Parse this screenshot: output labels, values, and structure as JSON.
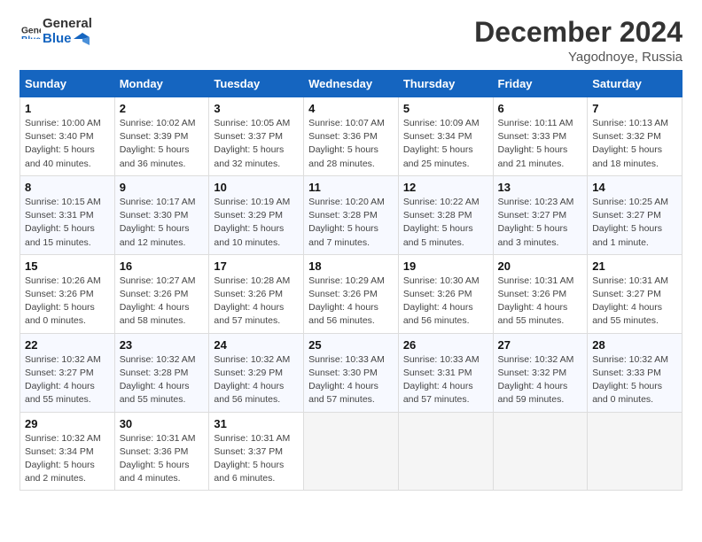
{
  "header": {
    "logo_line1": "General",
    "logo_line2": "Blue",
    "month": "December 2024",
    "location": "Yagodnoye, Russia"
  },
  "weekdays": [
    "Sunday",
    "Monday",
    "Tuesday",
    "Wednesday",
    "Thursday",
    "Friday",
    "Saturday"
  ],
  "weeks": [
    [
      {
        "day": "1",
        "sunrise": "Sunrise: 10:00 AM",
        "sunset": "Sunset: 3:40 PM",
        "daylight": "Daylight: 5 hours and 40 minutes."
      },
      {
        "day": "2",
        "sunrise": "Sunrise: 10:02 AM",
        "sunset": "Sunset: 3:39 PM",
        "daylight": "Daylight: 5 hours and 36 minutes."
      },
      {
        "day": "3",
        "sunrise": "Sunrise: 10:05 AM",
        "sunset": "Sunset: 3:37 PM",
        "daylight": "Daylight: 5 hours and 32 minutes."
      },
      {
        "day": "4",
        "sunrise": "Sunrise: 10:07 AM",
        "sunset": "Sunset: 3:36 PM",
        "daylight": "Daylight: 5 hours and 28 minutes."
      },
      {
        "day": "5",
        "sunrise": "Sunrise: 10:09 AM",
        "sunset": "Sunset: 3:34 PM",
        "daylight": "Daylight: 5 hours and 25 minutes."
      },
      {
        "day": "6",
        "sunrise": "Sunrise: 10:11 AM",
        "sunset": "Sunset: 3:33 PM",
        "daylight": "Daylight: 5 hours and 21 minutes."
      },
      {
        "day": "7",
        "sunrise": "Sunrise: 10:13 AM",
        "sunset": "Sunset: 3:32 PM",
        "daylight": "Daylight: 5 hours and 18 minutes."
      }
    ],
    [
      {
        "day": "8",
        "sunrise": "Sunrise: 10:15 AM",
        "sunset": "Sunset: 3:31 PM",
        "daylight": "Daylight: 5 hours and 15 minutes."
      },
      {
        "day": "9",
        "sunrise": "Sunrise: 10:17 AM",
        "sunset": "Sunset: 3:30 PM",
        "daylight": "Daylight: 5 hours and 12 minutes."
      },
      {
        "day": "10",
        "sunrise": "Sunrise: 10:19 AM",
        "sunset": "Sunset: 3:29 PM",
        "daylight": "Daylight: 5 hours and 10 minutes."
      },
      {
        "day": "11",
        "sunrise": "Sunrise: 10:20 AM",
        "sunset": "Sunset: 3:28 PM",
        "daylight": "Daylight: 5 hours and 7 minutes."
      },
      {
        "day": "12",
        "sunrise": "Sunrise: 10:22 AM",
        "sunset": "Sunset: 3:28 PM",
        "daylight": "Daylight: 5 hours and 5 minutes."
      },
      {
        "day": "13",
        "sunrise": "Sunrise: 10:23 AM",
        "sunset": "Sunset: 3:27 PM",
        "daylight": "Daylight: 5 hours and 3 minutes."
      },
      {
        "day": "14",
        "sunrise": "Sunrise: 10:25 AM",
        "sunset": "Sunset: 3:27 PM",
        "daylight": "Daylight: 5 hours and 1 minute."
      }
    ],
    [
      {
        "day": "15",
        "sunrise": "Sunrise: 10:26 AM",
        "sunset": "Sunset: 3:26 PM",
        "daylight": "Daylight: 5 hours and 0 minutes."
      },
      {
        "day": "16",
        "sunrise": "Sunrise: 10:27 AM",
        "sunset": "Sunset: 3:26 PM",
        "daylight": "Daylight: 4 hours and 58 minutes."
      },
      {
        "day": "17",
        "sunrise": "Sunrise: 10:28 AM",
        "sunset": "Sunset: 3:26 PM",
        "daylight": "Daylight: 4 hours and 57 minutes."
      },
      {
        "day": "18",
        "sunrise": "Sunrise: 10:29 AM",
        "sunset": "Sunset: 3:26 PM",
        "daylight": "Daylight: 4 hours and 56 minutes."
      },
      {
        "day": "19",
        "sunrise": "Sunrise: 10:30 AM",
        "sunset": "Sunset: 3:26 PM",
        "daylight": "Daylight: 4 hours and 56 minutes."
      },
      {
        "day": "20",
        "sunrise": "Sunrise: 10:31 AM",
        "sunset": "Sunset: 3:26 PM",
        "daylight": "Daylight: 4 hours and 55 minutes."
      },
      {
        "day": "21",
        "sunrise": "Sunrise: 10:31 AM",
        "sunset": "Sunset: 3:27 PM",
        "daylight": "Daylight: 4 hours and 55 minutes."
      }
    ],
    [
      {
        "day": "22",
        "sunrise": "Sunrise: 10:32 AM",
        "sunset": "Sunset: 3:27 PM",
        "daylight": "Daylight: 4 hours and 55 minutes."
      },
      {
        "day": "23",
        "sunrise": "Sunrise: 10:32 AM",
        "sunset": "Sunset: 3:28 PM",
        "daylight": "Daylight: 4 hours and 55 minutes."
      },
      {
        "day": "24",
        "sunrise": "Sunrise: 10:32 AM",
        "sunset": "Sunset: 3:29 PM",
        "daylight": "Daylight: 4 hours and 56 minutes."
      },
      {
        "day": "25",
        "sunrise": "Sunrise: 10:33 AM",
        "sunset": "Sunset: 3:30 PM",
        "daylight": "Daylight: 4 hours and 57 minutes."
      },
      {
        "day": "26",
        "sunrise": "Sunrise: 10:33 AM",
        "sunset": "Sunset: 3:31 PM",
        "daylight": "Daylight: 4 hours and 57 minutes."
      },
      {
        "day": "27",
        "sunrise": "Sunrise: 10:32 AM",
        "sunset": "Sunset: 3:32 PM",
        "daylight": "Daylight: 4 hours and 59 minutes."
      },
      {
        "day": "28",
        "sunrise": "Sunrise: 10:32 AM",
        "sunset": "Sunset: 3:33 PM",
        "daylight": "Daylight: 5 hours and 0 minutes."
      }
    ],
    [
      {
        "day": "29",
        "sunrise": "Sunrise: 10:32 AM",
        "sunset": "Sunset: 3:34 PM",
        "daylight": "Daylight: 5 hours and 2 minutes."
      },
      {
        "day": "30",
        "sunrise": "Sunrise: 10:31 AM",
        "sunset": "Sunset: 3:36 PM",
        "daylight": "Daylight: 5 hours and 4 minutes."
      },
      {
        "day": "31",
        "sunrise": "Sunrise: 10:31 AM",
        "sunset": "Sunset: 3:37 PM",
        "daylight": "Daylight: 5 hours and 6 minutes."
      },
      null,
      null,
      null,
      null
    ]
  ]
}
